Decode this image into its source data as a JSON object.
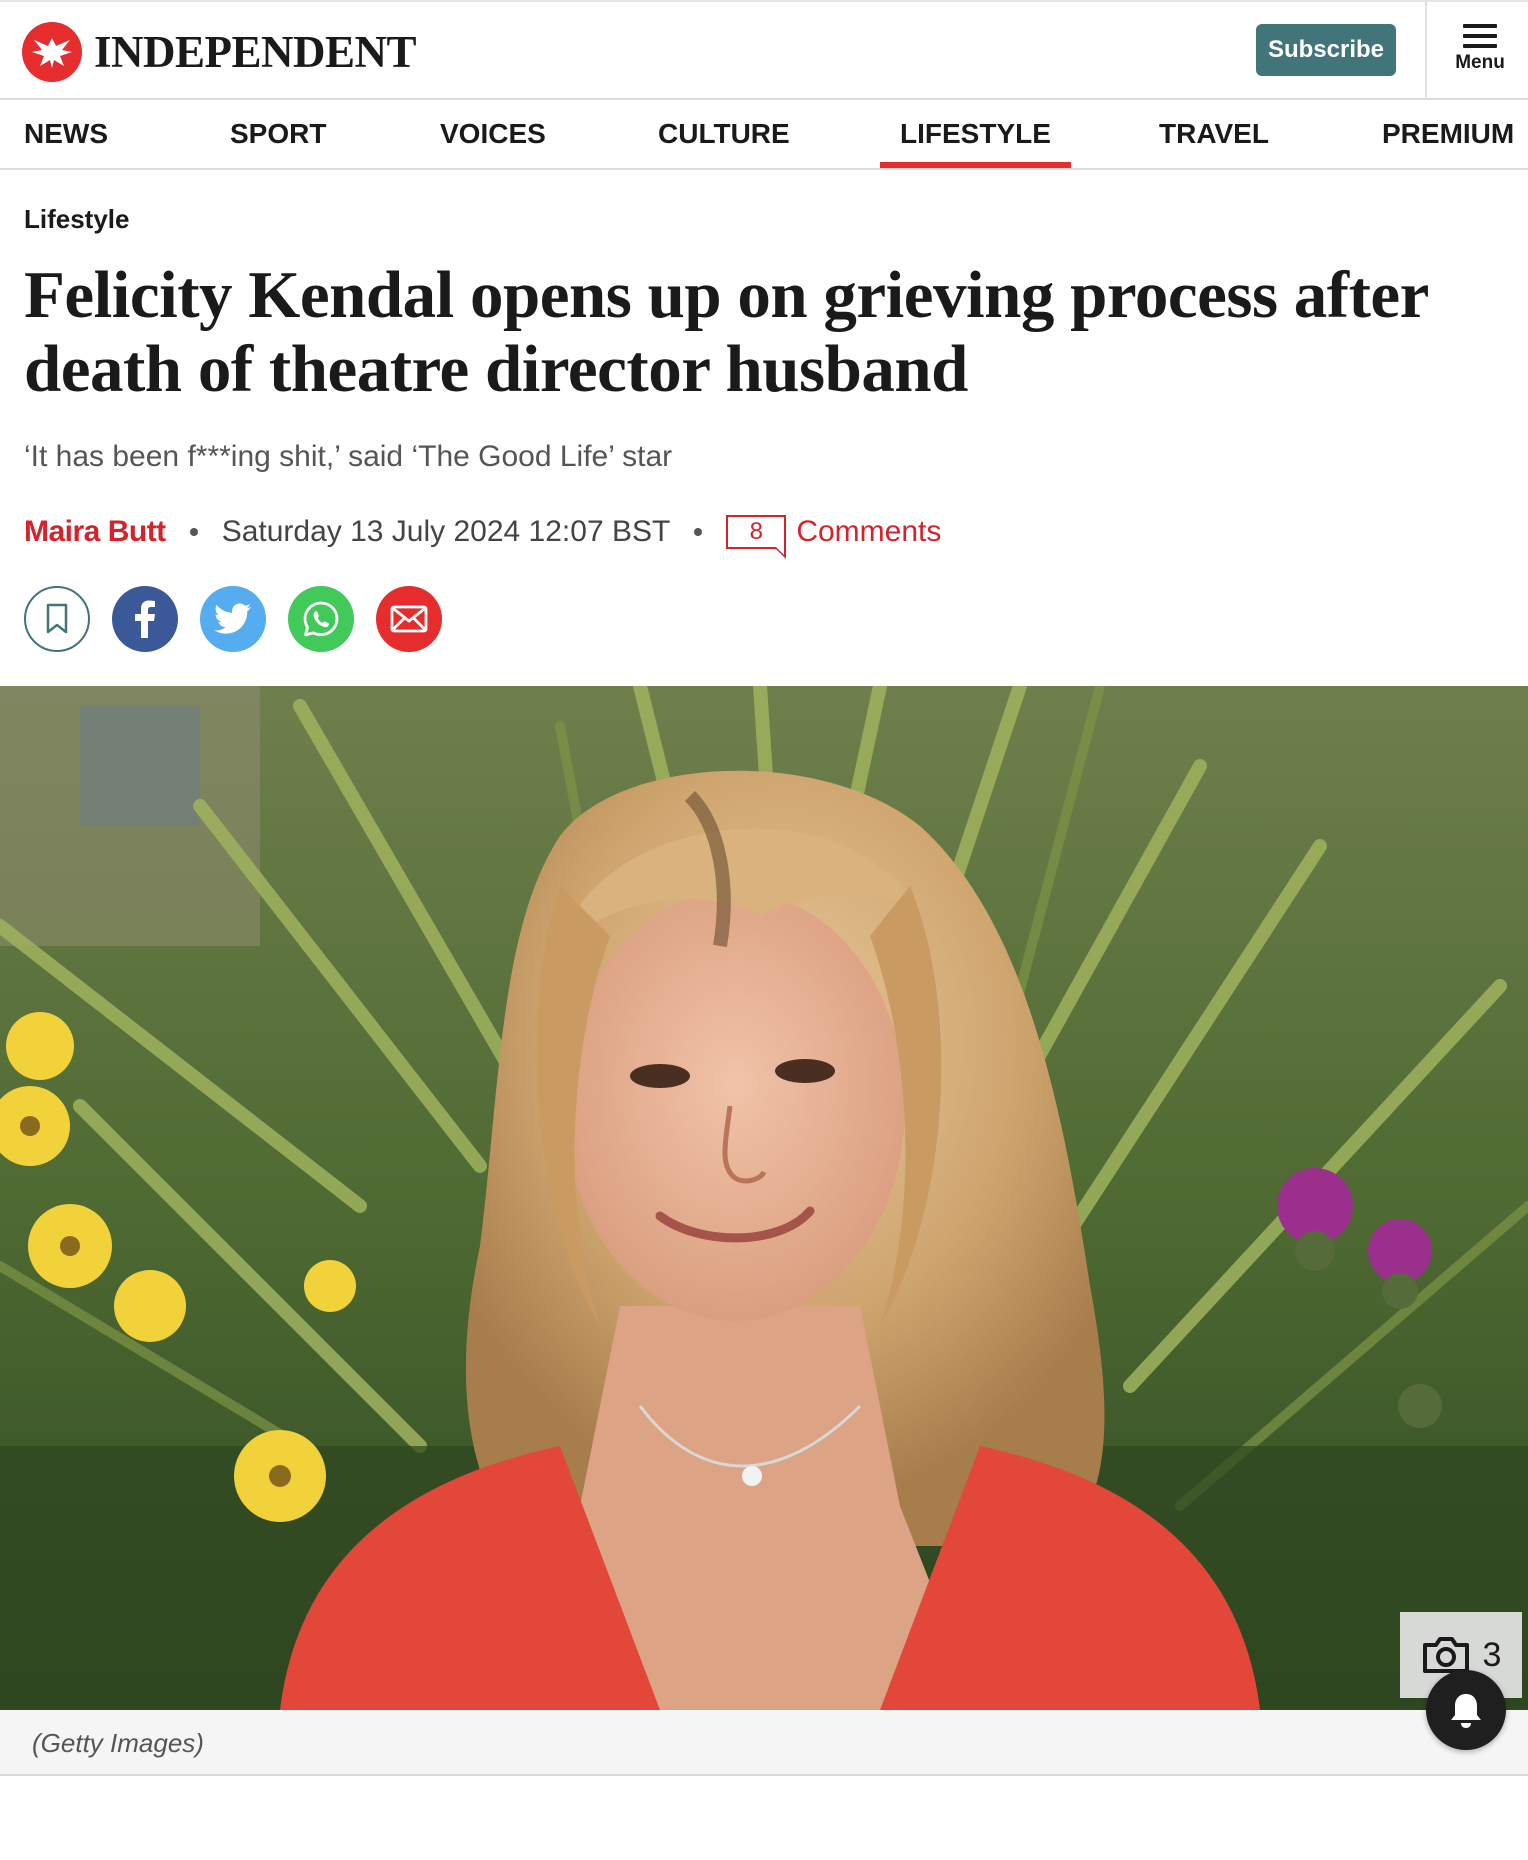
{
  "header": {
    "logo_text": "INDEPENDENT",
    "subscribe_label": "Subscribe",
    "menu_label": "Menu"
  },
  "nav": {
    "items": [
      {
        "label": "NEWS"
      },
      {
        "label": "SPORT"
      },
      {
        "label": "VOICES"
      },
      {
        "label": "CULTURE"
      },
      {
        "label": "LIFESTYLE",
        "active": true
      },
      {
        "label": "TRAVEL"
      },
      {
        "label": "PREMIUM"
      }
    ]
  },
  "article": {
    "section": "Lifestyle",
    "headline": "Felicity Kendal opens up on grieving process after death of theatre director husband",
    "standfirst": "‘It has been f***ing shit,’ said ‘The Good Life’ star",
    "author": "Maira Butt",
    "date": "Saturday 13 July 2024 12:07 BST",
    "comments_count": "8",
    "comments_label": "Comments",
    "share_icons": [
      "bookmark-icon",
      "facebook-icon",
      "twitter-icon",
      "whatsapp-icon",
      "email-icon"
    ]
  },
  "hero": {
    "caption": "(Getty Images)",
    "gallery_count": "3"
  },
  "colors": {
    "brand_red": "#e52d2d",
    "subscribe_teal": "#41757a",
    "facebook": "#3b5998",
    "twitter": "#55acee",
    "whatsapp": "#41c95a"
  }
}
